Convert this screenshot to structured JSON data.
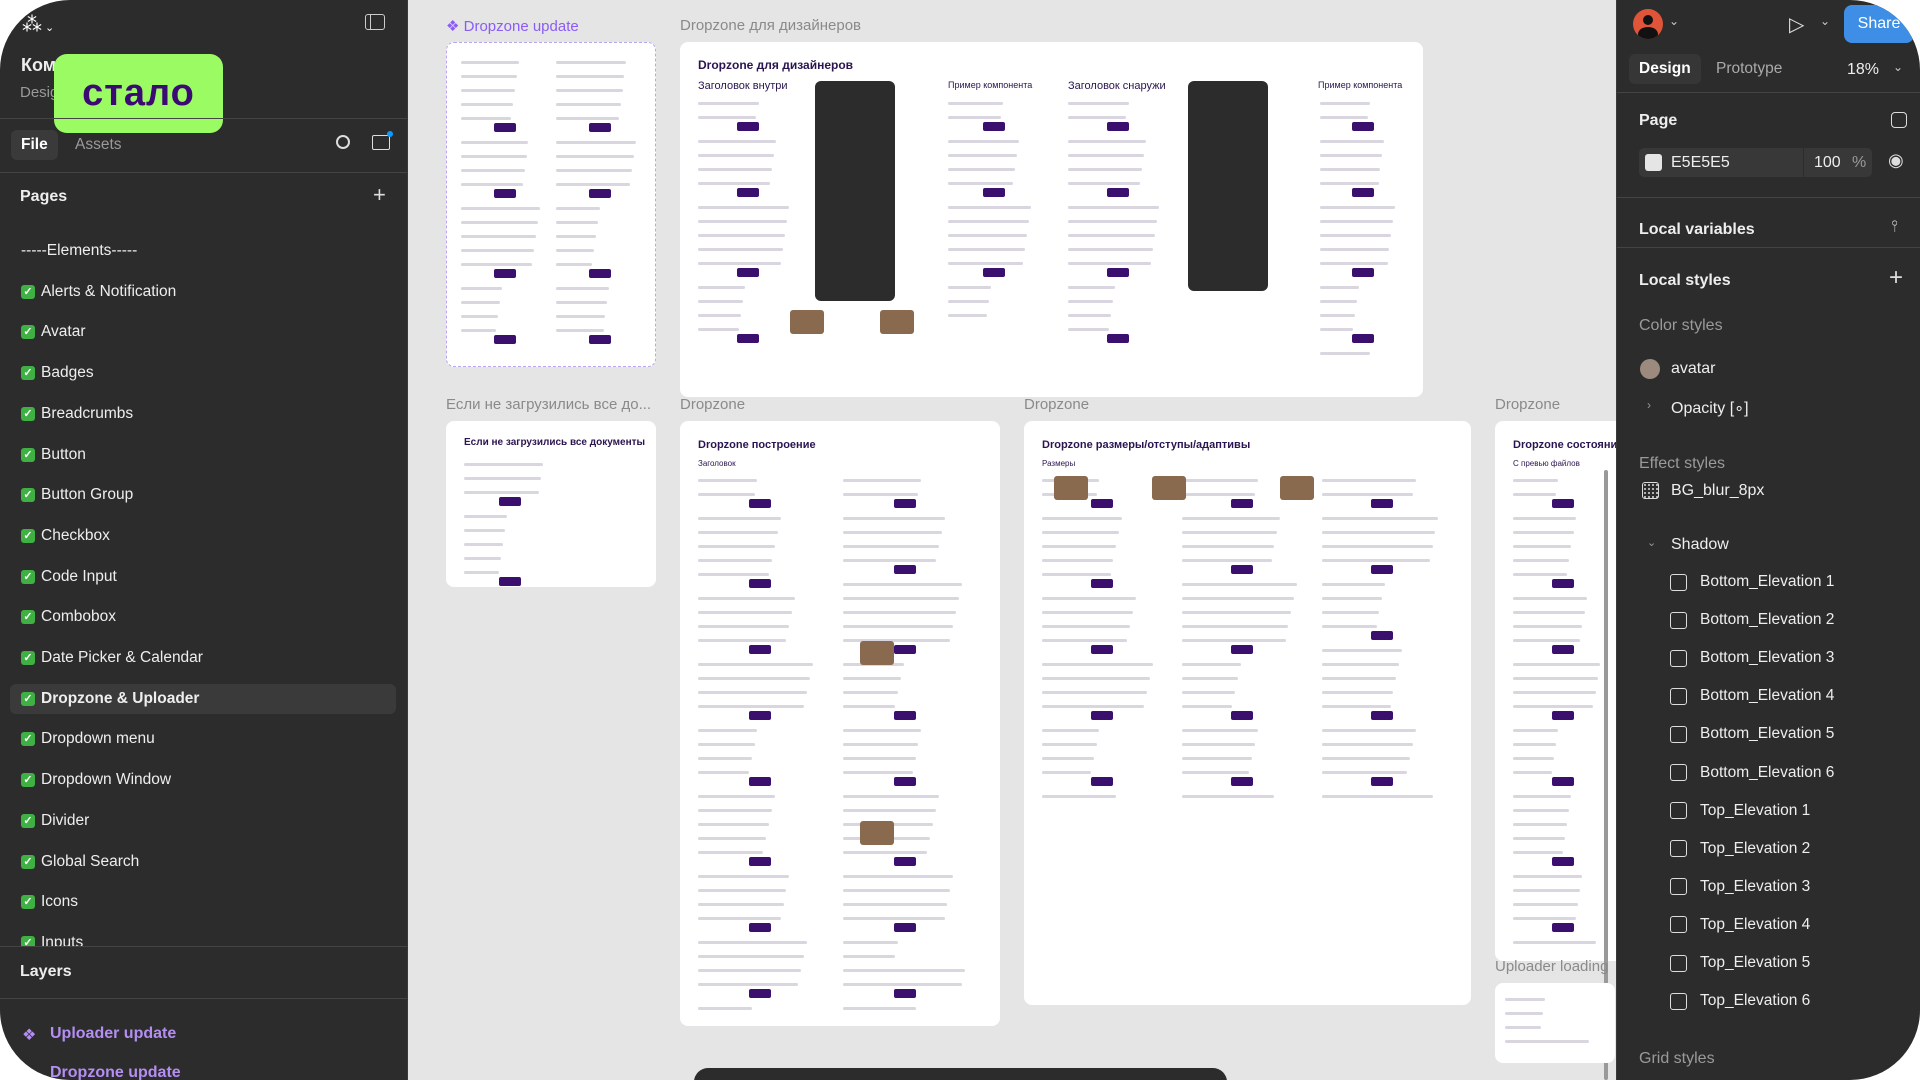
{
  "left": {
    "file_title": "Ком",
    "file_subtitle": "Design",
    "sticker": "стало",
    "tabs": [
      "File",
      "Assets"
    ],
    "pages_title": "Pages",
    "pages": [
      "-----Elements-----",
      "Alerts & Notification",
      "Avatar",
      "Badges",
      "Breadcrumbs",
      "Button",
      "Button Group",
      "Checkbox",
      "Code Input",
      "Combobox",
      "Date Picker & Calendar",
      "Dropzone & Uploader",
      "Dropdown menu",
      "Dropdown Window",
      "Divider",
      "Global Search",
      "Icons",
      "Inputs"
    ],
    "selected_page": "Dropzone & Uploader",
    "layers_title": "Layers",
    "layers": [
      "Uploader update",
      "Dropzone update"
    ],
    "layer_color": "#b48ef2"
  },
  "canvas": {
    "background": "#E5E5E5",
    "frames": {
      "dropzone_update": "Dropzone update",
      "designers_label": "Dropzone для дизайнеров",
      "designers_title": "Dropzone для дизайнеров",
      "inside": "Заголовок внутри",
      "outside": "Заголовок снаружи",
      "example1": "Пример компонента",
      "example2": "Пример компонента",
      "not_loaded_label": "Если не загрузились все до...",
      "not_loaded_title": "Если не загрузились все документы",
      "build_label": "Dropzone",
      "build_title": "Dropzone построение",
      "build_sub": "Заголовок",
      "sizes_label": "Dropzone",
      "sizes_title": "Dropzone размеры/отступы/адаптивы",
      "sizes_sub": "Размеры",
      "states_label": "Dropzone",
      "states_title": "Dropzone состояния",
      "states_sub": "С превью файлов",
      "uploader_label": "Uploader loading"
    }
  },
  "right": {
    "tabs": [
      "Design",
      "Prototype"
    ],
    "zoom": "18%",
    "share": "Share",
    "page_title": "Page",
    "page_color": "E5E5E5",
    "page_opacity": "100",
    "percent": "%",
    "local_variables": "Local variables",
    "local_styles": "Local styles",
    "color_styles": "Color styles",
    "color_items": [
      "avatar",
      "Opacity [∘]"
    ],
    "effect_styles": "Effect styles",
    "blur": "BG_blur_8px",
    "shadow": "Shadow",
    "elevations": [
      "Bottom_Elevation 1",
      "Bottom_Elevation 2",
      "Bottom_Elevation 3",
      "Bottom_Elevation 4",
      "Bottom_Elevation 5",
      "Bottom_Elevation 6",
      "Top_Elevation 1",
      "Top_Elevation 2",
      "Top_Elevation 3",
      "Top_Elevation 4",
      "Top_Elevation 5",
      "Top_Elevation 6"
    ],
    "grid_styles": "Grid styles",
    "accent": "#0d99ff"
  }
}
